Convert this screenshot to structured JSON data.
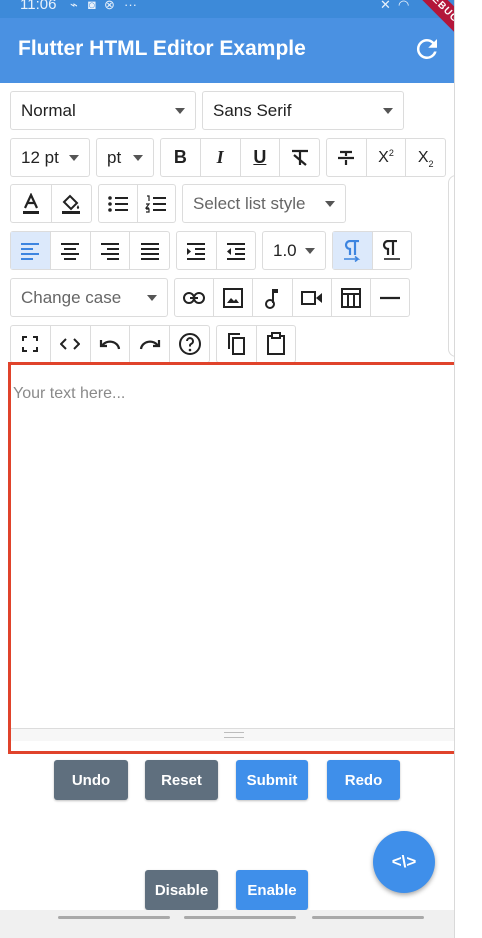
{
  "status_bar": {
    "time": "11:06",
    "dots": "···"
  },
  "app_bar": {
    "title": "Flutter HTML Editor Example",
    "debug_banner": "DEBUG"
  },
  "toolbar": {
    "style_dropdown": "Normal",
    "font_dropdown": "Sans Serif",
    "font_size_dropdown": "12 pt",
    "font_unit_dropdown": "pt",
    "bold": "B",
    "italic": "I",
    "underline": "U",
    "superscript": "X",
    "subscript": "X",
    "list_style_dropdown": "Select list style",
    "line_height_dropdown": "1.0",
    "case_dropdown": "Change case"
  },
  "editor": {
    "placeholder": "Your text here..."
  },
  "buttons": {
    "undo": "Undo",
    "reset": "Reset",
    "submit": "Submit",
    "redo": "Redo",
    "disable": "Disable",
    "enable": "Enable",
    "fab": "<\\>"
  },
  "colors": {
    "app_bar": "#4a91e2",
    "accent": "#3f8fea",
    "gray_button": "#5f6f7e",
    "editor_border": "#e0432b",
    "active": "#dce9fb"
  }
}
